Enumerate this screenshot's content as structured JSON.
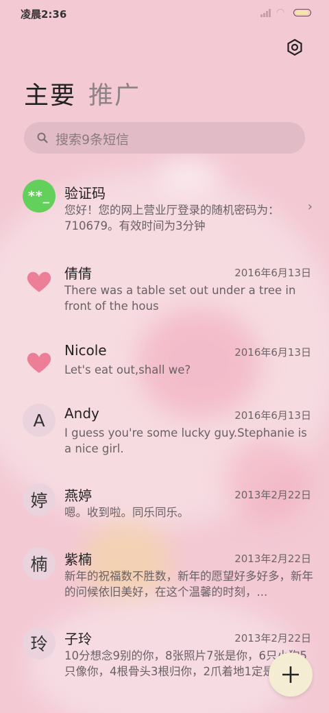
{
  "status": {
    "time": "凌晨2:36"
  },
  "tabs": {
    "main": "主要",
    "promo": "推广"
  },
  "search": {
    "placeholder": "搜索9条短信"
  },
  "messages": [
    {
      "avatar_text": "**_",
      "avatar_type": "code",
      "name": "验证码",
      "date": "",
      "text": "您好！您的网上营业厅登录的随机密码为：710679。有效时间为3分钟",
      "chevron": "›"
    },
    {
      "avatar_text": "",
      "avatar_type": "heart",
      "name": "倩倩",
      "date": "2016年6月13日",
      "text": "There was a table set out under a tree in front of the hous"
    },
    {
      "avatar_text": "",
      "avatar_type": "heart",
      "name": "Nicole",
      "date": "2016年6月13日",
      "text": "Let's eat out,shall we?"
    },
    {
      "avatar_text": "A",
      "avatar_type": "letter",
      "name": "Andy",
      "date": "2016年6月13日",
      "text": "I guess you're some lucky guy.Stephanie is a nice girl."
    },
    {
      "avatar_text": "婷",
      "avatar_type": "letter",
      "name": "燕婷",
      "date": "2013年2月22日",
      "text": "嗯。收到啦。同乐同乐。"
    },
    {
      "avatar_text": "楠",
      "avatar_type": "letter",
      "name": "紫楠",
      "date": "2013年2月22日",
      "text": "新年的祝福数不胜数，新年的愿望好多好多，新年的问候依旧美好，在这个温馨的时刻，..."
    },
    {
      "avatar_text": "玲",
      "avatar_type": "letter",
      "name": "子玲",
      "date": "2013年2月22日",
      "text": "10分想念9别的你，8张照片7张是你，6只小狗5只像你，4根骨头3根归你，2爪着地1定是你"
    }
  ],
  "icons": {
    "settings": "gear-icon",
    "search": "search-icon",
    "compose": "plus-icon"
  },
  "colors": {
    "background": "#f3c9d4",
    "code_avatar": "#63d05c",
    "fab": "#f5ecd4"
  }
}
